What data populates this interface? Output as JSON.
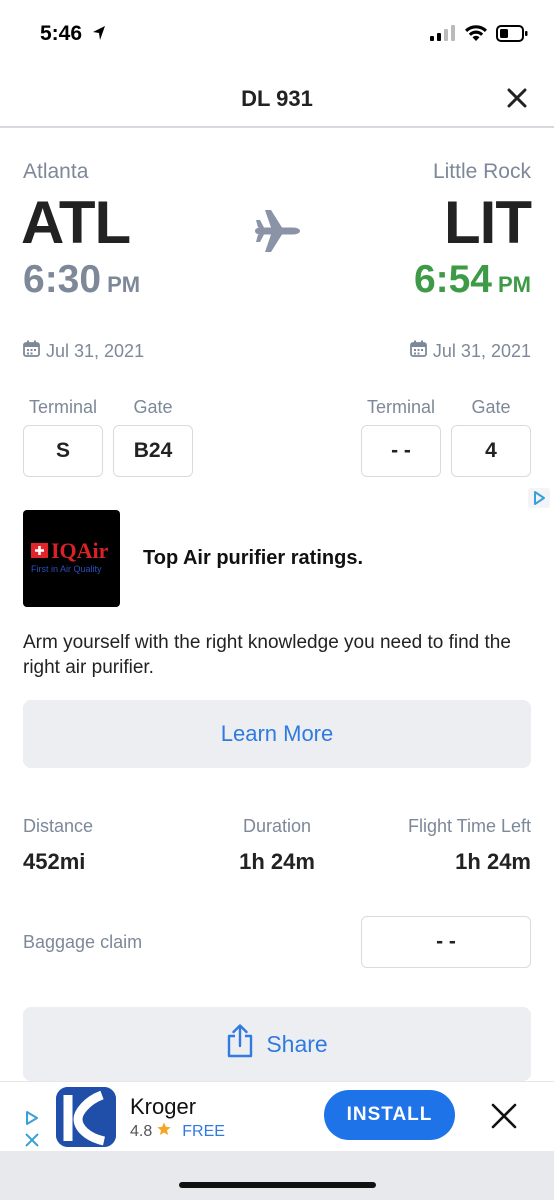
{
  "status": {
    "time": "5:46"
  },
  "header": {
    "title": "DL 931"
  },
  "departure": {
    "city": "Atlanta",
    "code": "ATL",
    "time": "6:30",
    "ampm": "PM",
    "date": "Jul 31, 2021",
    "terminal_label": "Terminal",
    "gate_label": "Gate",
    "terminal": "S",
    "gate": "B24"
  },
  "arrival": {
    "city": "Little Rock",
    "code": "LIT",
    "time": "6:54",
    "ampm": "PM",
    "date": "Jul 31, 2021",
    "terminal_label": "Terminal",
    "gate_label": "Gate",
    "terminal": "- -",
    "gate": "4"
  },
  "ad": {
    "logo_text": "IQAir",
    "logo_tagline": "First in Air Quality",
    "headline": "Top Air purifier ratings.",
    "body": "Arm yourself with the right knowledge you need to find the right air purifier.",
    "cta": "Learn More"
  },
  "stats": {
    "distance_label": "Distance",
    "distance": "452mi",
    "duration_label": "Duration",
    "duration": "1h 24m",
    "time_left_label": "Flight Time Left",
    "time_left": "1h 24m"
  },
  "baggage": {
    "label": "Baggage claim",
    "value": "- -"
  },
  "share": {
    "label": "Share"
  },
  "banner": {
    "app_name": "Kroger",
    "rating": "4.8",
    "price": "FREE",
    "install": "INSTALL"
  },
  "colors": {
    "accent": "#2f7be0",
    "arrival_time": "#3d9a46",
    "muted": "#7d8899",
    "install": "#1f73e8"
  }
}
